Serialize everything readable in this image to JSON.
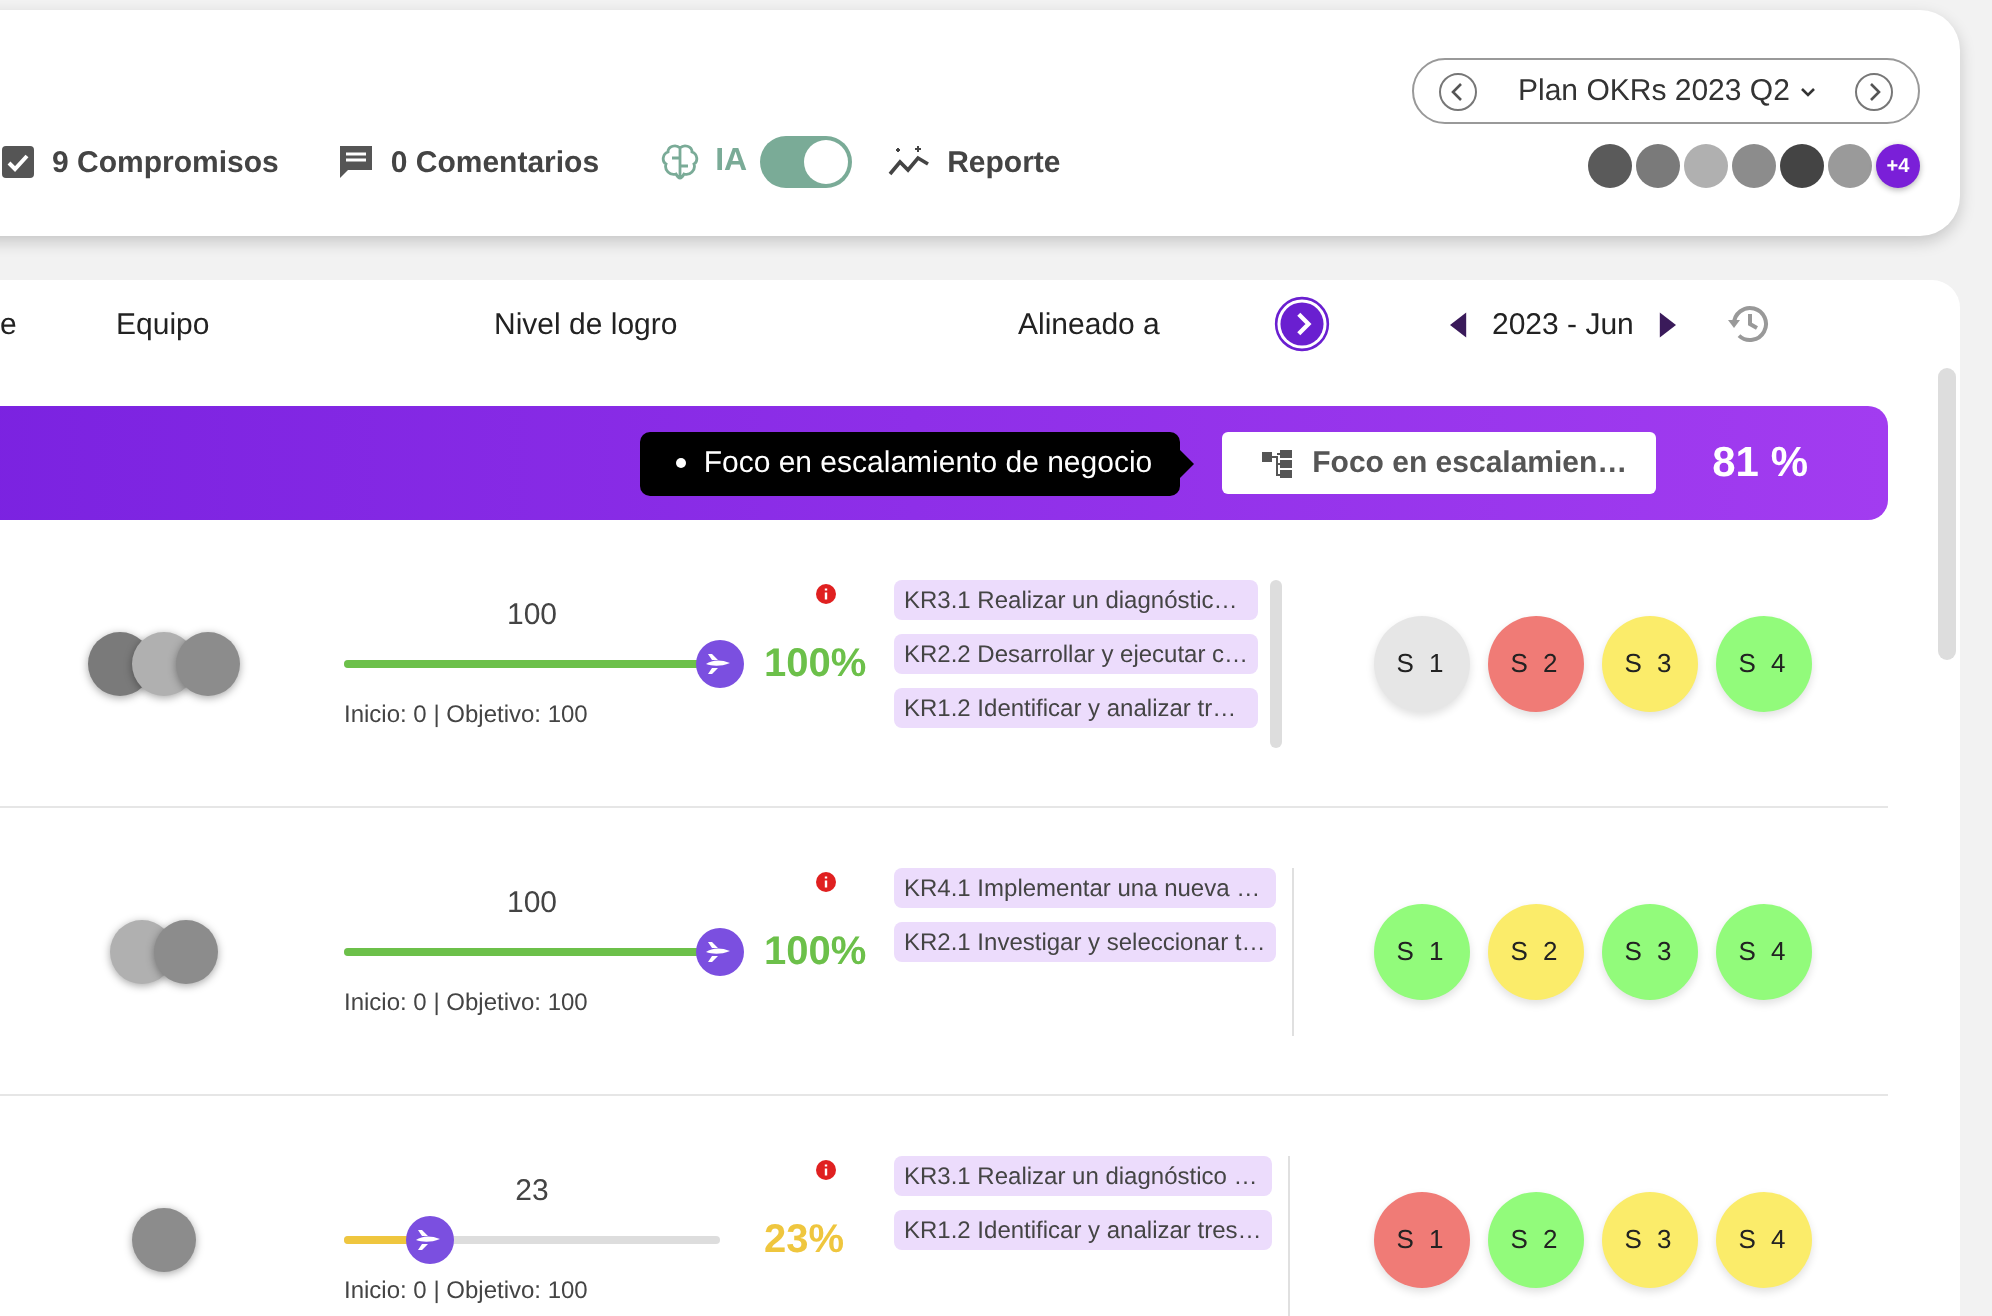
{
  "toolbar": {
    "commitments": "9 Compromisos",
    "comments": "0 Comentarios",
    "ai": {
      "label": "IA",
      "on": true
    },
    "report": "Reporte"
  },
  "plan_selector": {
    "label": "Plan OKRs 2023 Q2"
  },
  "members": [
    {
      "kind": "photo"
    },
    {
      "kind": "photo"
    },
    {
      "kind": "photo"
    },
    {
      "kind": "photo"
    },
    {
      "kind": "photo"
    },
    {
      "kind": "photo"
    },
    {
      "kind": "more",
      "label": "+4"
    }
  ],
  "table": {
    "columns": [
      "e",
      "Equipo",
      "Nivel de logro",
      "Alineado a"
    ],
    "period": "2023 - Jun"
  },
  "banner": {
    "tooltip": "Foco en escalamiento de negocio",
    "focus": "Foco en escalamien…",
    "percent": "81 %"
  },
  "rows": [
    {
      "team": [
        {
          "kind": "photo"
        },
        {
          "kind": "photo"
        },
        {
          "kind": "photo"
        }
      ],
      "value": "100",
      "level": 1.0,
      "percent": "100%",
      "color": "#6cc04a",
      "warning": true,
      "range": "Inicio: 0 | Objetivo: 100",
      "kr_scroll": true,
      "krs": [
        "KR3.1 Realizar un diagnóstic…",
        "KR2.2 Desarrollar y ejecutar c…",
        "KR1.2 Identificar y analizar tr…"
      ],
      "statuses": [
        {
          "label": "S 1",
          "color": "#e6e6e6"
        },
        {
          "label": "S 2",
          "color": "#f07b76"
        },
        {
          "label": "S 3",
          "color": "#fbec6a"
        },
        {
          "label": "S 4",
          "color": "#92fb7b"
        }
      ]
    },
    {
      "team": [
        {
          "kind": "photo"
        },
        {
          "kind": "photo"
        }
      ],
      "value": "100",
      "level": 1.0,
      "percent": "100%",
      "color": "#6cc04a",
      "warning": true,
      "range": "Inicio: 0 | Objetivo: 100",
      "kr_scroll": false,
      "krs": [
        "KR4.1 Implementar una nueva …",
        "KR2.1 Investigar y seleccionar t…"
      ],
      "statuses": [
        {
          "label": "S 1",
          "color": "#92fb7b"
        },
        {
          "label": "S 2",
          "color": "#fbec6a"
        },
        {
          "label": "S 3",
          "color": "#92fb7b"
        },
        {
          "label": "S 4",
          "color": "#92fb7b"
        }
      ]
    },
    {
      "team": [
        {
          "kind": "photo"
        }
      ],
      "value": "23",
      "level": 0.23,
      "percent": "23%",
      "color": "#efc63e",
      "warning": true,
      "range": "Inicio: 0 | Objetivo: 100",
      "kr_scroll": false,
      "krs": [
        "KR3.1 Realizar un diagnóstico …",
        "KR1.2 Identificar y analizar tres…"
      ],
      "statuses": [
        {
          "label": "S 1",
          "color": "#f07b76"
        },
        {
          "label": "S 2",
          "color": "#92fb7b"
        },
        {
          "label": "S 3",
          "color": "#fbec6a"
        },
        {
          "label": "S 4",
          "color": "#fbec6a"
        }
      ]
    }
  ]
}
